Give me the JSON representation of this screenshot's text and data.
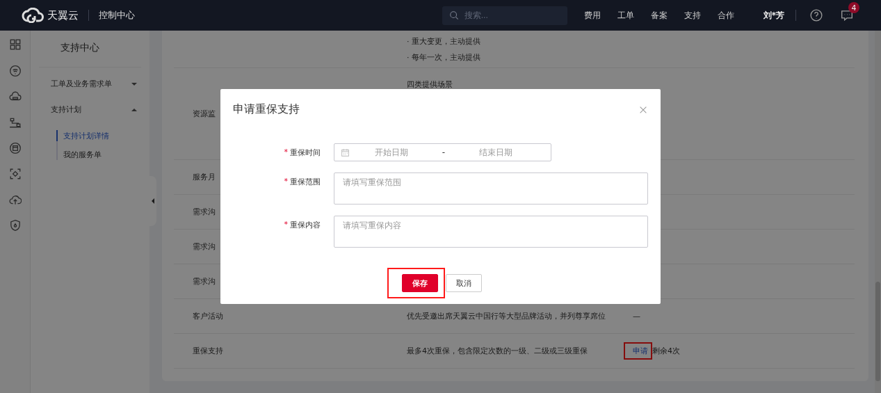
{
  "header": {
    "logo_text": "天翼云",
    "console": "控制中心",
    "search": {
      "placeholder": "搜索..."
    },
    "nav": [
      "费用",
      "工单",
      "备案",
      "支持",
      "合作"
    ],
    "user": "刘*芳",
    "notification_count": "4"
  },
  "sidebar": {
    "title": "支持中心",
    "groups": [
      {
        "label": "工单及业务需求单",
        "expanded": false
      },
      {
        "label": "支持计划",
        "expanded": true,
        "children": [
          {
            "label": "支持计划详情",
            "selected": true
          },
          {
            "label": "我的服务单",
            "selected": false
          }
        ]
      }
    ]
  },
  "table": {
    "rows": [
      {
        "kind": "tall",
        "description_lines": [
          "· 重大变更，主动提供",
          "· 每年一次，主动提供"
        ]
      },
      {
        "kind": "big",
        "name": "资源监",
        "description_lines": [
          "四类提供场景"
        ]
      },
      {
        "kind": "normal",
        "name": "服务月"
      },
      {
        "kind": "normal",
        "name": "需求沟"
      },
      {
        "kind": "normal",
        "name": "需求沟"
      },
      {
        "kind": "normal",
        "name": "需求沟"
      },
      {
        "kind": "normal",
        "name": "客户活动",
        "description_lines": [
          "优先受邀出席天翼云中国行等大型品牌活动，并列尊享席位"
        ],
        "column_3": {
          "kind": "text",
          "text": "—"
        }
      },
      {
        "kind": "normal",
        "name": "重保支持",
        "description_lines": [
          "最多4次重保，包含限定次数的一级、二级或三级重保"
        ],
        "column_3": {
          "kind": "action",
          "link": "申请",
          "highlighted": true,
          "note": "剩余4次"
        }
      }
    ]
  },
  "modal": {
    "title": "申请重保支持",
    "fields": [
      {
        "kind": "daterange",
        "required_mark": "*",
        "label": "重保时间",
        "start_placeholder": "开始日期",
        "separator": "-",
        "end_placeholder": "结束日期"
      },
      {
        "kind": "textarea",
        "required_mark": "*",
        "label": "重保范围",
        "placeholder": "请填写重保范围"
      },
      {
        "kind": "textarea",
        "required_mark": "*",
        "label": "重保内容",
        "placeholder": "请填写重保内容"
      }
    ],
    "buttons": [
      {
        "kind": "primary",
        "label": "保存",
        "highlighted": true
      },
      {
        "kind": "default",
        "label": "取消",
        "highlighted": false
      }
    ]
  }
}
